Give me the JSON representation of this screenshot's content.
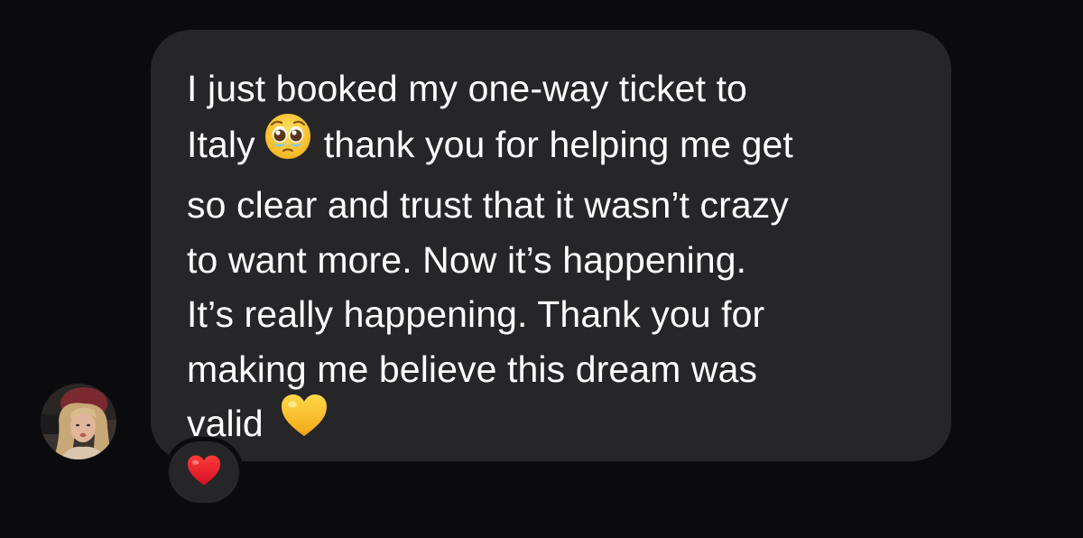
{
  "message": {
    "lines": [
      "I just booked my one-way ticket to",
      "Italy",
      "thank you for helping me get",
      "so clear and trust that it wasn’t crazy",
      "to want more. Now it’s happening.",
      "It’s really happening. Thank you for",
      "making me believe this dream was",
      "valid"
    ],
    "emojis": [
      "pleading-face-icon",
      "yellow-heart-icon"
    ]
  },
  "reaction": {
    "icon": "red-heart-icon"
  },
  "colors": {
    "background": "#0b0b0d",
    "bubble": "#262628",
    "text": "#ffffff",
    "heart_red": "#e8192c",
    "heart_yellow": "#f7c325"
  }
}
